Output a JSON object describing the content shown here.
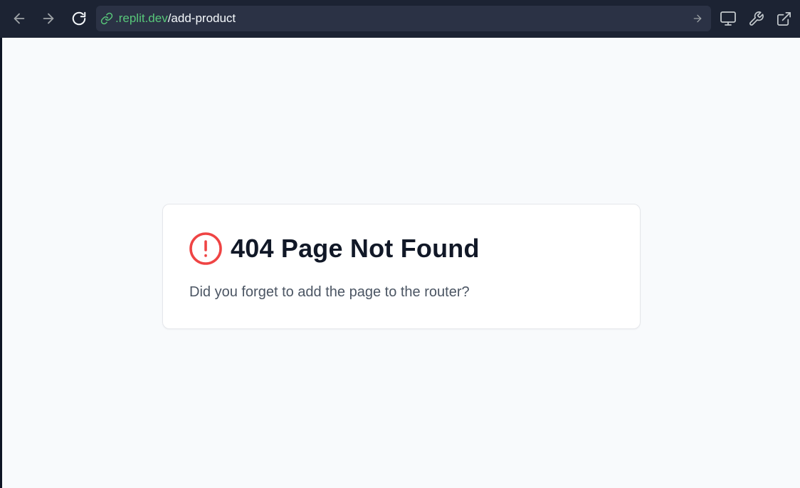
{
  "browser": {
    "url_domain": ".replit.dev",
    "url_path": "/add-product"
  },
  "icons": {
    "back": "arrow-left-icon",
    "forward": "arrow-right-icon",
    "reload": "reload-icon",
    "link": "link-icon",
    "go": "arrow-right-icon",
    "devtools": "monitor-icon",
    "tools": "wrench-icon",
    "open_external": "external-link-icon",
    "alert": "alert-circle-icon"
  },
  "colors": {
    "url_domain": "#58c77a",
    "alert": "#ef4444",
    "title": "#111827",
    "body_text": "#4b5563"
  },
  "page": {
    "title": "404 Page Not Found",
    "message": "Did you forget to add the page to the router?"
  }
}
